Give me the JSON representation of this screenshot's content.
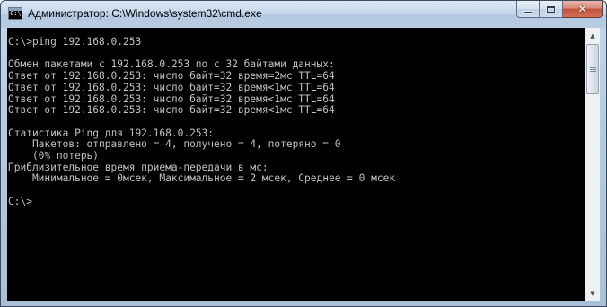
{
  "window": {
    "title": "Администратор: C:\\Windows\\system32\\cmd.exe",
    "icon_text": "C:\\",
    "buttons": {
      "minimize": "minimize-icon",
      "maximize": "maximize-icon",
      "close": "close-icon"
    }
  },
  "console": {
    "lines": [
      "C:\\>ping 192.168.0.253",
      "",
      "Обмен пакетами с 192.168.0.253 по с 32 байтами данных:",
      "Ответ от 192.168.0.253: число байт=32 время=2мс TTL=64",
      "Ответ от 192.168.0.253: число байт=32 время<1мс TTL=64",
      "Ответ от 192.168.0.253: число байт=32 время<1мс TTL=64",
      "Ответ от 192.168.0.253: число байт=32 время<1мс TTL=64",
      "",
      "Статистика Ping для 192.168.0.253:",
      "    Пакетов: отправлено = 4, получено = 4, потеряно = 0",
      "    (0% потерь)",
      "Приблизительное время приема-передачи в мс:",
      "    Минимальное = 0мсек, Максимальное = 2 мсек, Среднее = 0 мсек",
      "",
      "C:\\>"
    ]
  },
  "colors": {
    "console_background": "#000000",
    "console_text": "#c0c0c0",
    "frame": "#b6cbe2",
    "close_button": "#c4523d"
  }
}
